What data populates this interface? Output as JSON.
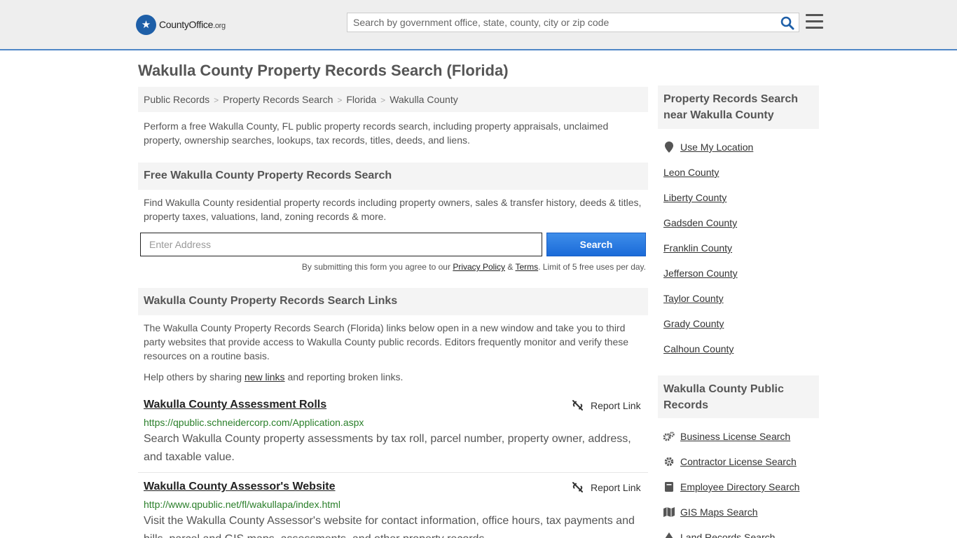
{
  "header": {
    "logo_main": "CountyOffice",
    "logo_suffix": ".org",
    "search_placeholder": "Search by government office, state, county, city or zip code"
  },
  "page_title": "Wakulla County Property Records Search (Florida)",
  "breadcrumb": [
    "Public Records",
    "Property Records Search",
    "Florida",
    "Wakulla County"
  ],
  "intro": "Perform a free Wakulla County, FL public property records search, including property appraisals, unclaimed property, ownership searches, lookups, tax records, titles, deeds, and liens.",
  "free_search": {
    "heading": "Free Wakulla County Property Records Search",
    "description": "Find Wakulla County residential property records including property owners, sales & transfer history, deeds & titles, property taxes, valuations, land, zoning records & more.",
    "address_placeholder": "Enter Address",
    "button_label": "Search",
    "disclaimer_prefix": "By submitting this form you agree to our ",
    "privacy_label": "Privacy Policy",
    "amp": " & ",
    "terms_label": "Terms",
    "disclaimer_suffix": ". Limit of 5 free uses per day."
  },
  "links_section": {
    "heading": "Wakulla County Property Records Search Links",
    "description": "The Wakulla County Property Records Search (Florida) links below open in a new window and take you to third party websites that provide access to Wakulla County public records. Editors frequently monitor and verify these resources on a routine basis.",
    "help_prefix": "Help others by sharing ",
    "help_link": "new links",
    "help_suffix": " and reporting broken links.",
    "report_label": "Report Link",
    "items": [
      {
        "title": "Wakulla County Assessment Rolls",
        "url": "https://qpublic.schneidercorp.com/Application.aspx",
        "desc": "Search Wakulla County property assessments by tax roll, parcel number, property owner, address, and taxable value."
      },
      {
        "title": "Wakulla County Assessor's Website",
        "url": "http://www.qpublic.net/fl/wakullapa/index.html",
        "desc": "Visit the Wakulla County Assessor's website for contact information, office hours, tax payments and bills, parcel and GIS maps, assessments, and other property records."
      }
    ]
  },
  "sidebar": {
    "nearby_heading": "Property Records Search near Wakulla County",
    "use_location": "Use My Location",
    "nearby": [
      "Leon County",
      "Liberty County",
      "Gadsden County",
      "Franklin County",
      "Jefferson County",
      "Taylor County",
      "Grady County",
      "Calhoun County"
    ],
    "public_heading": "Wakulla County Public Records",
    "public_records": [
      {
        "label": "Business License Search",
        "icon": "gears-icon"
      },
      {
        "label": "Contractor License Search",
        "icon": "gear-icon"
      },
      {
        "label": "Employee Directory Search",
        "icon": "book-icon"
      },
      {
        "label": "GIS Maps Search",
        "icon": "map-icon"
      },
      {
        "label": "Land Records Search",
        "icon": "tree-icon"
      }
    ]
  }
}
